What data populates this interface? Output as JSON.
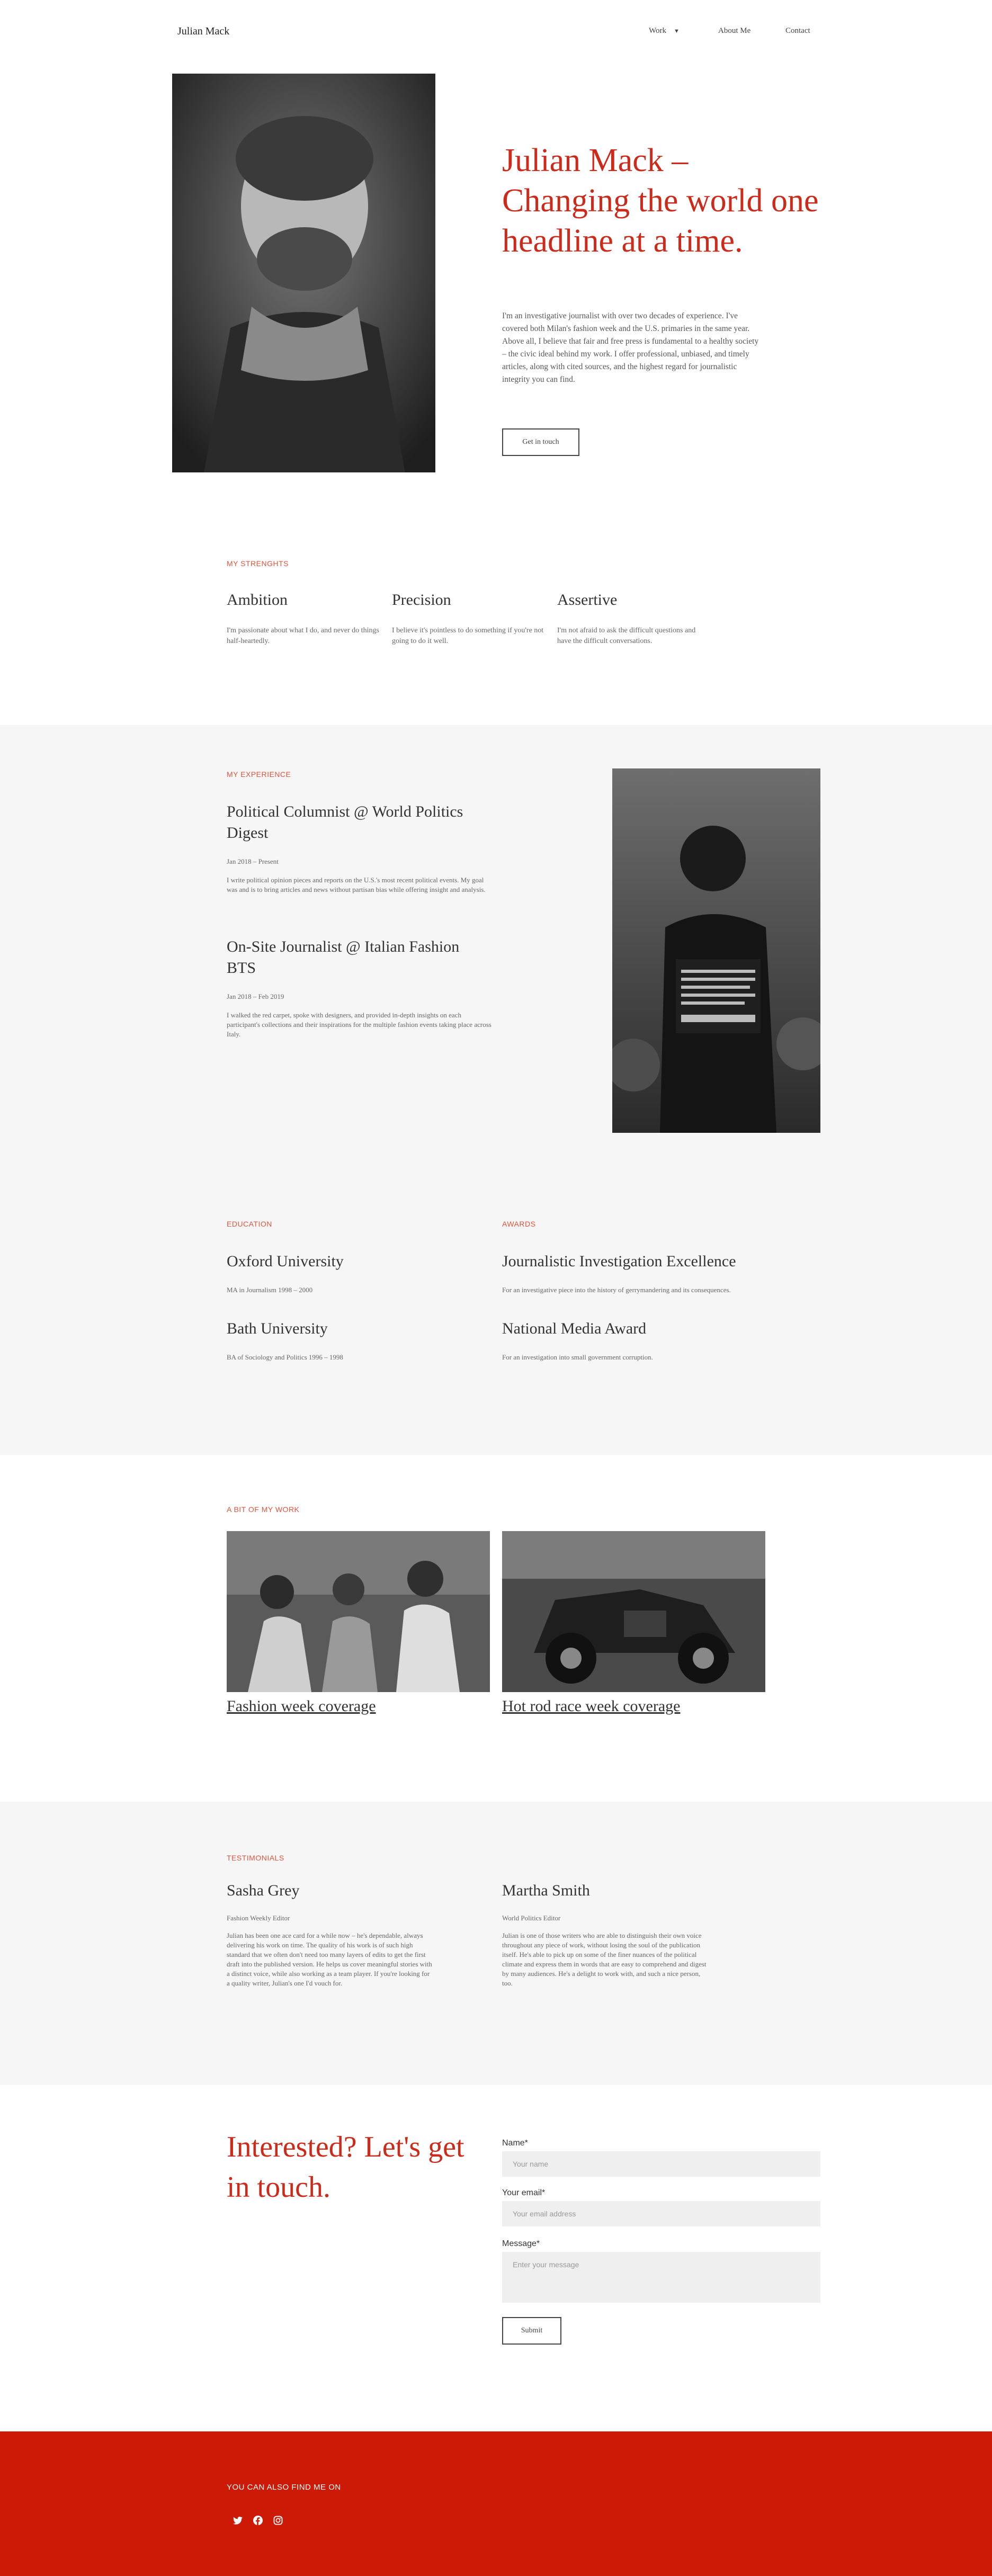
{
  "header": {
    "logo": "Julian Mack",
    "nav": [
      {
        "label": "Work",
        "has_dropdown": true
      },
      {
        "label": "About Me"
      },
      {
        "label": "Contact"
      }
    ]
  },
  "hero": {
    "title": "Julian Mack – Changing the world one headline at a time.",
    "text": "I'm an investigative journalist with over two decades of experience. I've covered both Milan's fashion week and the U.S. primaries in the same year. Above all, I believe that fair and free press is fundamental to a healthy society – the civic ideal behind my work. I offer professional, unbiased, and timely articles, along with cited sources, and the highest regard for journalistic integrity you can find.",
    "button": "Get in touch"
  },
  "strengths": {
    "eyebrow": "MY STRENGHTS",
    "items": [
      {
        "title": "Ambition",
        "text": "I'm passionate about what I do, and never do things half-heartedly."
      },
      {
        "title": "Precision",
        "text": "I believe it's pointless to do something if you're not going to do it well."
      },
      {
        "title": "Assertive",
        "text": "I'm not afraid to ask the difficult questions and have the difficult conversations."
      }
    ]
  },
  "experience": {
    "eyebrow": "MY EXPERIENCE",
    "items": [
      {
        "title": "Political Columnist @ World Politics Digest",
        "dates": "Jan 2018 – Present",
        "text": "I write political opinion pieces and reports on the U.S.'s most recent political events. My goal was and is to bring articles and news without partisan bias while offering insight and analysis."
      },
      {
        "title": "On-Site Journalist @ Italian Fashion BTS",
        "dates": "Jan 2018 – Feb 2019",
        "text": "I walked the red carpet, spoke with designers, and provided in-depth insights on each participant's collections and their inspirations for the multiple fashion events taking place across Italy."
      }
    ]
  },
  "education": {
    "eyebrow": "EDUCATION",
    "items": [
      {
        "title": "Oxford University",
        "text": "MA in Journalism 1998 – 2000"
      },
      {
        "title": "Bath University",
        "text": "BA of Sociology and Politics 1996 – 1998"
      }
    ]
  },
  "awards": {
    "eyebrow": "AWARDS",
    "items": [
      {
        "title": "Journalistic Investigation Excellence",
        "text": "For an investigative piece into the history of gerrymandering and its consequences."
      },
      {
        "title": "National Media Award",
        "text": "For an investigation into small government corruption."
      }
    ]
  },
  "work": {
    "eyebrow": "A BIT OF MY WORK",
    "items": [
      {
        "title": "Fashion week coverage"
      },
      {
        "title": "Hot rod race week coverage"
      }
    ]
  },
  "testimonials": {
    "eyebrow": "TESTIMONIALS",
    "items": [
      {
        "name": "Sasha Grey",
        "role": "Fashion Weekly Editor",
        "text": "Julian has been one ace card for a while now – he's dependable, always delivering his work on time. The quality of his work is of such high standard that we often don't need too many layers of edits to get the first draft into the published version. He helps us cover meaningful stories with a distinct voice, while also working as a team player. If you're looking for a quality writer, Julian's one I'd vouch for."
      },
      {
        "name": "Martha Smith",
        "role": "World Politics Editor",
        "text": "Julian is one of those writers who are able to distinguish their own voice throughout any piece of work, without losing the soul of the publication itself. He's able to pick up on some of the finer nuances of the political climate and express them in words that are easy to comprehend and digest by many audiences. He's a delight to work with, and such a nice person, too."
      }
    ]
  },
  "contact": {
    "title": "Interested? Let's get in touch.",
    "name_label": "Name*",
    "name_placeholder": "Your name",
    "email_label": "Your email*",
    "email_placeholder": "Your email address",
    "message_label": "Message*",
    "message_placeholder": "Enter your message",
    "submit": "Submit"
  },
  "footer": {
    "label": "YOU CAN ALSO FIND ME ON",
    "icons": [
      "twitter-icon",
      "facebook-icon",
      "instagram-icon"
    ]
  },
  "colors": {
    "accent": "#cc2a1a",
    "footer_bg": "#cc1a06",
    "section_grey": "#f6f6f6"
  }
}
